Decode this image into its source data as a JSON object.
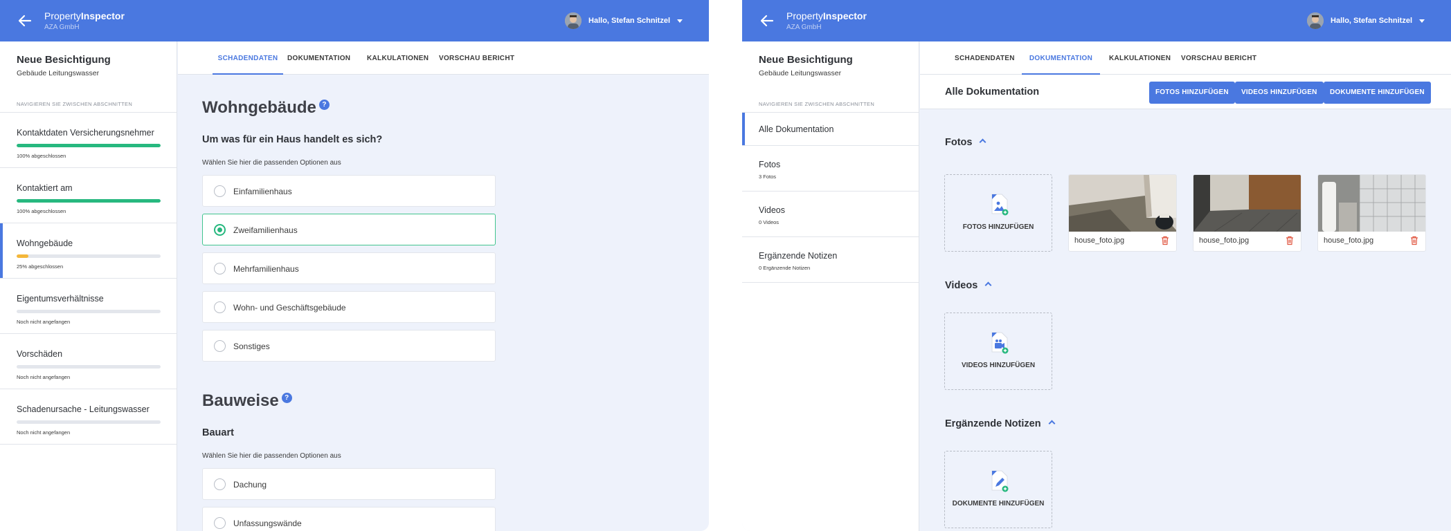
{
  "header": {
    "brand_light": "Property",
    "brand_bold": "Inspector",
    "company": "AZA GmbH",
    "greeting": "Hallo, Stefan Schnitzel"
  },
  "sidebar": {
    "title": "Neue Besichtigung",
    "subtitle": "Gebäude Leitungswasser",
    "nav_caption": "NAVIGIEREN SIE ZWISCHEN ABSCHNITTEN",
    "sections": [
      {
        "name": "Kontaktdaten Versicherungsnehmer",
        "status": "100% abgeschlossen",
        "progress": 1.0,
        "color": "#27b87f"
      },
      {
        "name": "Kontaktiert am",
        "status": "100% abgeschlossen",
        "progress": 1.0,
        "color": "#27b87f"
      },
      {
        "name": "Wohngebäude",
        "status": "25% abgeschlossen",
        "progress": 0.08,
        "color": "#f4b73a"
      },
      {
        "name": "Eigentumsverhältnisse",
        "status": "Noch nicht angefangen",
        "progress": 0,
        "color": "#27b87f"
      },
      {
        "name": "Vorschäden",
        "status": "Noch nicht angefangen",
        "progress": 0,
        "color": "#27b87f"
      },
      {
        "name": "Schadenursache - Leitungswasser",
        "status": "Noch nicht angefangen",
        "progress": 0,
        "color": "#27b87f"
      }
    ]
  },
  "tabs": [
    "SCHADENDATEN",
    "DOKUMENTATION",
    "KALKULATIONEN",
    "VORSCHAU BERICHT"
  ],
  "form": {
    "section1_title": "Wohngebäude",
    "question1": "Um was für ein Haus handelt es sich?",
    "hint1": "Wählen Sie hier die passenden Optionen aus",
    "options1": [
      "Einfamilienhaus",
      "Zweifamilienhaus",
      "Mehrfamilienhaus",
      "Wohn- und Geschäftsgebäude",
      "Sonstiges"
    ],
    "selected1": "Zweifamilienhaus",
    "section2_title": "Bauweise",
    "question2": "Bauart",
    "hint2": "Wählen Sie hier die passenden Optionen aus",
    "options2": [
      "Dachung",
      "Unfassungswände"
    ],
    "help_glyph": "?"
  },
  "docs": {
    "sidebar_items": [
      {
        "name": "Alle Dokumentation",
        "count": ""
      },
      {
        "name": "Fotos",
        "count": "3 Fotos"
      },
      {
        "name": "Videos",
        "count": "0 Videos"
      },
      {
        "name": "Ergänzende Notizen",
        "count": "0 Ergänzende Notizen"
      }
    ],
    "toolbar_title": "Alle Dokumentation",
    "buttons": [
      "FOTOS HINZUFÜGEN",
      "VIDEOS HINZUFÜGEN",
      "DOKUMENTE HINZUFÜGEN"
    ],
    "fotos_title": "Fotos",
    "videos_title": "Videos",
    "notes_title": "Ergänzende Notizen",
    "add_fotos": "FOTOS HINZUFÜGEN",
    "add_videos": "VIDEOS HINZUFÜGEN",
    "add_docs": "DOKUMENTE HINZUFÜGEN",
    "photos": [
      "house_foto.jpg",
      "house_foto.jpg",
      "house_foto.jpg"
    ]
  },
  "colors": {
    "accent": "#4a78e0",
    "success": "#27b87f",
    "warning": "#f4b73a",
    "delete": "#e0553f"
  }
}
